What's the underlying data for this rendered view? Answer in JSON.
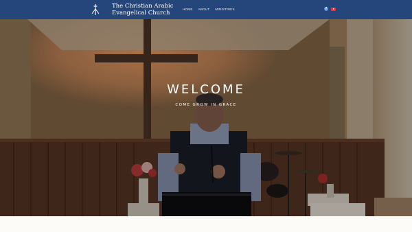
{
  "header": {
    "site_title": "The Christian Arabic Evangelical Church",
    "nav": [
      {
        "label": "HOME"
      },
      {
        "label": "ABOUT"
      },
      {
        "label": "MINISTRIES"
      }
    ],
    "social": [
      {
        "icon": "facebook-icon",
        "color": "#5b8fe6"
      },
      {
        "icon": "youtube-icon",
        "color": "#e13a3a"
      }
    ],
    "background_color": "#25467a"
  },
  "hero": {
    "heading": "WELCOME",
    "subheading": "COME GROW IN GRACE"
  }
}
